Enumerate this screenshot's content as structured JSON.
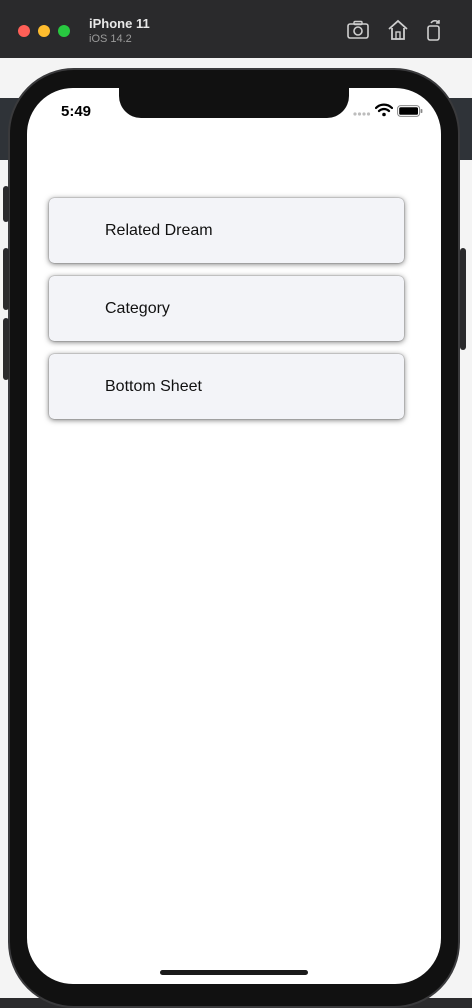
{
  "simulator": {
    "device_name": "iPhone 11",
    "os_version": "iOS 14.2"
  },
  "status_bar": {
    "time": "5:49"
  },
  "menu": {
    "items": [
      {
        "label": "Related Dream"
      },
      {
        "label": "Category"
      },
      {
        "label": "Bottom Sheet"
      }
    ]
  },
  "colors": {
    "card_background": "#f3f4f8",
    "screen_background": "#ffffff",
    "titlebar_background": "#2a2a2c"
  }
}
